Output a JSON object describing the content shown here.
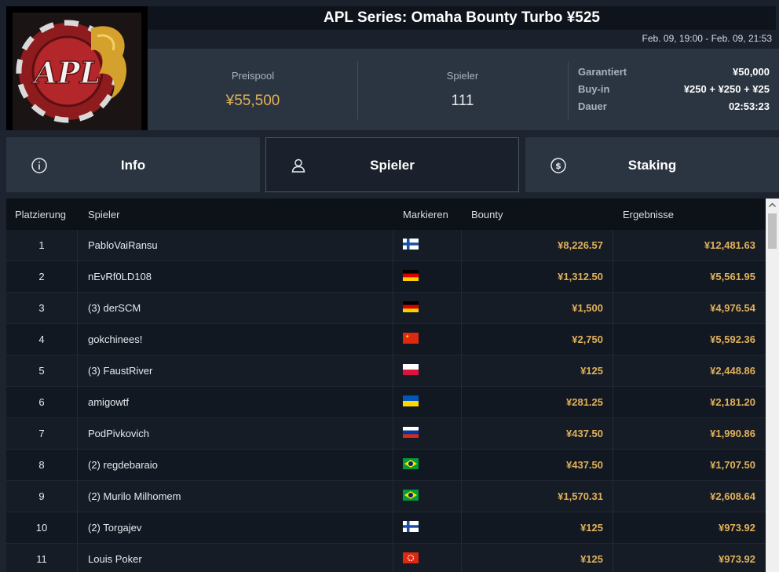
{
  "header": {
    "title": "APL Series: Omaha Bounty Turbo ¥525",
    "dates": "Feb. 09, 19:00 - Feb. 09, 21:53",
    "logo_text": "APL"
  },
  "stats": {
    "prizepool_label": "Preispool",
    "prizepool_value": "¥55,500",
    "players_label": "Spieler",
    "players_value": "111",
    "details": [
      {
        "key": "Garantiert",
        "value": "¥50,000"
      },
      {
        "key": "Buy-in",
        "value": "¥250 + ¥250 + ¥25"
      },
      {
        "key": "Dauer",
        "value": "02:53:23"
      }
    ]
  },
  "tabs": [
    {
      "label": "Info",
      "icon": "info-icon"
    },
    {
      "label": "Spieler",
      "icon": "user-icon",
      "active": true
    },
    {
      "label": "Staking",
      "icon": "dollar-coin-icon"
    }
  ],
  "table": {
    "columns": [
      "Platzierung",
      "Spieler",
      "Markieren",
      "Bounty",
      "Ergebnisse"
    ],
    "rows": [
      {
        "rank": "1",
        "name": "PabloVaiRansu",
        "flag": "FI",
        "bounty": "¥8,226.57",
        "result": "¥12,481.63"
      },
      {
        "rank": "2",
        "name": "nEvRf0LD108",
        "flag": "DE",
        "bounty": "¥1,312.50",
        "result": "¥5,561.95"
      },
      {
        "rank": "3",
        "name": "(3) derSCM",
        "flag": "DE",
        "bounty": "¥1,500",
        "result": "¥4,976.54"
      },
      {
        "rank": "4",
        "name": "gokchinees!",
        "flag": "CN",
        "bounty": "¥2,750",
        "result": "¥5,592.36"
      },
      {
        "rank": "5",
        "name": "(3) FaustRiver",
        "flag": "PL",
        "bounty": "¥125",
        "result": "¥2,448.86"
      },
      {
        "rank": "6",
        "name": "amigowtf",
        "flag": "UA",
        "bounty": "¥281.25",
        "result": "¥2,181.20"
      },
      {
        "rank": "7",
        "name": "PodPivkovich",
        "flag": "RU",
        "bounty": "¥437.50",
        "result": "¥1,990.86"
      },
      {
        "rank": "8",
        "name": "(2) regdebaraio",
        "flag": "BR",
        "bounty": "¥437.50",
        "result": "¥1,707.50"
      },
      {
        "rank": "9",
        "name": "(2) Murilo Milhomem",
        "flag": "BR",
        "bounty": "¥1,570.31",
        "result": "¥2,608.64"
      },
      {
        "rank": "10",
        "name": "(2) Torgajev",
        "flag": "FI",
        "bounty": "¥125",
        "result": "¥973.92"
      },
      {
        "rank": "11",
        "name": "Louis Poker",
        "flag": "HK",
        "bounty": "¥125",
        "result": "¥973.92"
      }
    ]
  },
  "colors": {
    "accent_gold": "#e0b15a",
    "panel": "#2b3441",
    "background": "#1d2430"
  }
}
